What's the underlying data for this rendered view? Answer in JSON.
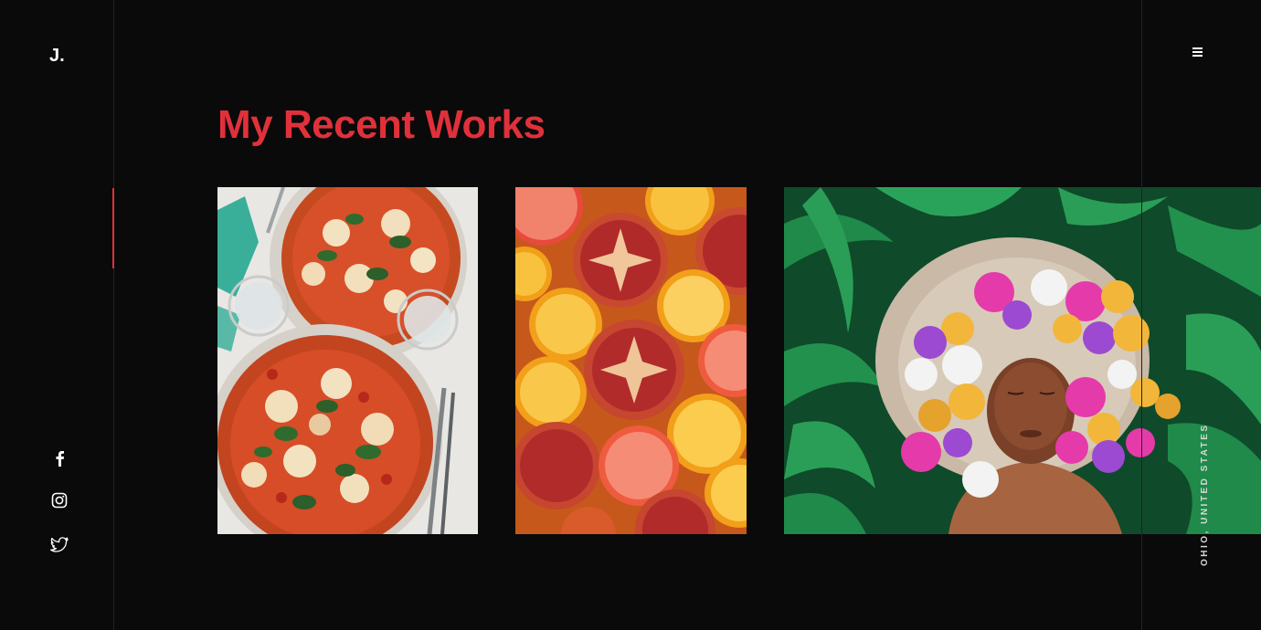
{
  "brand": {
    "logo_text": "J."
  },
  "header": {
    "title": "My Recent Works"
  },
  "menu": {
    "icon": "hamburger-menu-icon"
  },
  "social": [
    {
      "name": "facebook",
      "icon": "facebook-icon"
    },
    {
      "name": "instagram",
      "icon": "instagram-icon"
    },
    {
      "name": "twitter",
      "icon": "twitter-icon"
    }
  ],
  "address": {
    "vertical_text": "OHIO, UNITED STATES"
  },
  "works": [
    {
      "id": "pizza",
      "subject": "pizza"
    },
    {
      "id": "citrus",
      "subject": "citrus"
    },
    {
      "id": "flowers",
      "subject": "flower portrait"
    }
  ],
  "colors": {
    "accent": "#e0313b",
    "background": "#0a0a0a",
    "divider": "#222222",
    "text": "#ffffff"
  }
}
